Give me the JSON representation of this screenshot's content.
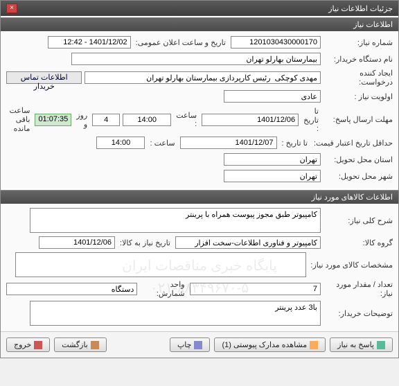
{
  "window": {
    "title": "جزئیات اطلاعات نیاز"
  },
  "sec1": {
    "header": "اطلاعات نیاز",
    "need_no_lbl": "شماره نیاز:",
    "need_no": "1201030430000170",
    "ann_dt_lbl": "تاریخ و ساعت اعلان عمومی:",
    "ann_dt": "1401/12/02 - 12:42",
    "buyer_lbl": "نام دستگاه خریدار:",
    "buyer": "بیمارستان بهارلو تهران",
    "requester_lbl": "ایجاد کننده درخواست:",
    "requester": "مهدی کوچکی  رئیس کارپردازی بیمارستان بهارلو تهران",
    "contact_btn": "اطلاعات تماس خریدار",
    "priority_lbl": "اولویت نیاز :",
    "priority": "عادی",
    "deadline_lbl": "مهلت ارسال پاسخ:",
    "to_date_lbl": "تا تاریخ :",
    "deadline_date": "1401/12/06",
    "time_lbl": "ساعت :",
    "deadline_time": "14:00",
    "days": "4",
    "days_lbl": "روز و",
    "remain_timer": "01:07:35",
    "remain_lbl": "ساعت باقی مانده",
    "valid_lbl": "حداقل تاریخ اعتبار قیمت:",
    "valid_date": "1401/12/07",
    "valid_time": "14:00",
    "prov_lbl": "استان محل تحویل:",
    "prov": "تهران",
    "city_lbl": "شهر محل تحویل:",
    "city": "تهران"
  },
  "sec2": {
    "header": "اطلاعات کالاهای مورد نیاز",
    "desc_lbl": "شرح کلی نیاز:",
    "desc": "کامپیوتر طبق مجوز پیوست همراه با پرینتر",
    "group_lbl": "گروه کالا:",
    "group": "کامپیوتر و فناوری اطلاعات-سخت افزار",
    "need_date_lbl": "تاریخ نیاز به کالا:",
    "need_date": "1401/12/06",
    "spec_lbl": "مشخصات کالای مورد نیاز:",
    "spec": "",
    "qty_lbl": "تعداد / مقدار مورد نیاز:",
    "qty": "7",
    "unit_lbl": "واحد شمارش:",
    "unit": "دستگاه",
    "buyer_note_lbl": "توضیحات خریدار:",
    "buyer_note": "با3 عدد پرینتر"
  },
  "buttons": {
    "respond": "پاسخ به نیاز",
    "attach": "مشاهده مدارک پیوستی (1)",
    "print": "چاپ",
    "back": "بازگشت",
    "exit": "خروج"
  },
  "watermark": {
    "l1": "پایگاه خبری مناقصات ایران",
    "l2": "۰۲۱-۸۸۳۴۹۶۷۰-۵"
  }
}
